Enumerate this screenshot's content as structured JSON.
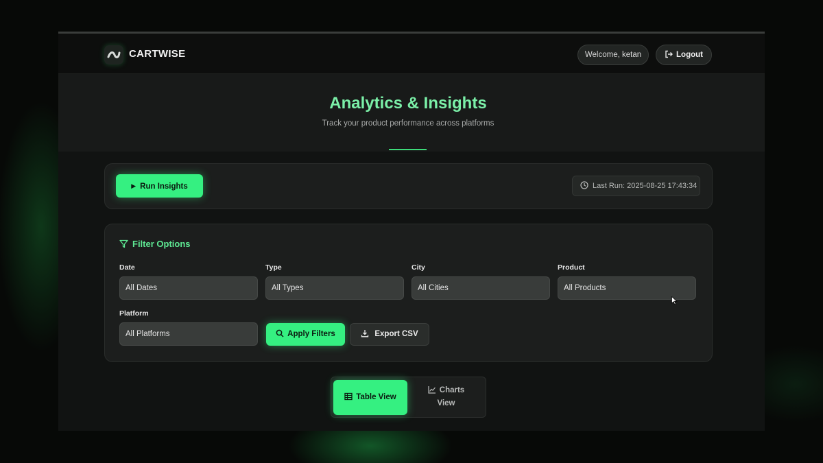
{
  "header": {
    "brand": "CARTWISE",
    "welcome": "Welcome, ketan",
    "logout_label": "Logout"
  },
  "hero": {
    "title": "Analytics & Insights",
    "subtitle": "Track your product performance across platforms"
  },
  "run_panel": {
    "run_label": "Run Insights",
    "last_run": "Last Run: 2025-08-25 17:43:34"
  },
  "filters": {
    "title": "Filter Options",
    "date": {
      "label": "Date",
      "value": "All Dates"
    },
    "type": {
      "label": "Type",
      "value": "All Types"
    },
    "city": {
      "label": "City",
      "value": "All Cities"
    },
    "product": {
      "label": "Product",
      "value": "All Products"
    },
    "platform": {
      "label": "Platform",
      "value": "All Platforms"
    },
    "apply_label": "Apply Filters",
    "export_label": "Export CSV"
  },
  "view_toggle": {
    "table_label": "Table View",
    "charts_line1": "Charts",
    "charts_line2": "View",
    "active": "table"
  },
  "colors": {
    "accent": "#35f081",
    "title_green": "#7bf0a8",
    "background": "#111312"
  },
  "icons": [
    "logo-icon",
    "logout-icon",
    "play-icon",
    "clock-icon",
    "funnel-icon",
    "search-icon",
    "download-icon",
    "table-icon",
    "line-chart-icon"
  ]
}
